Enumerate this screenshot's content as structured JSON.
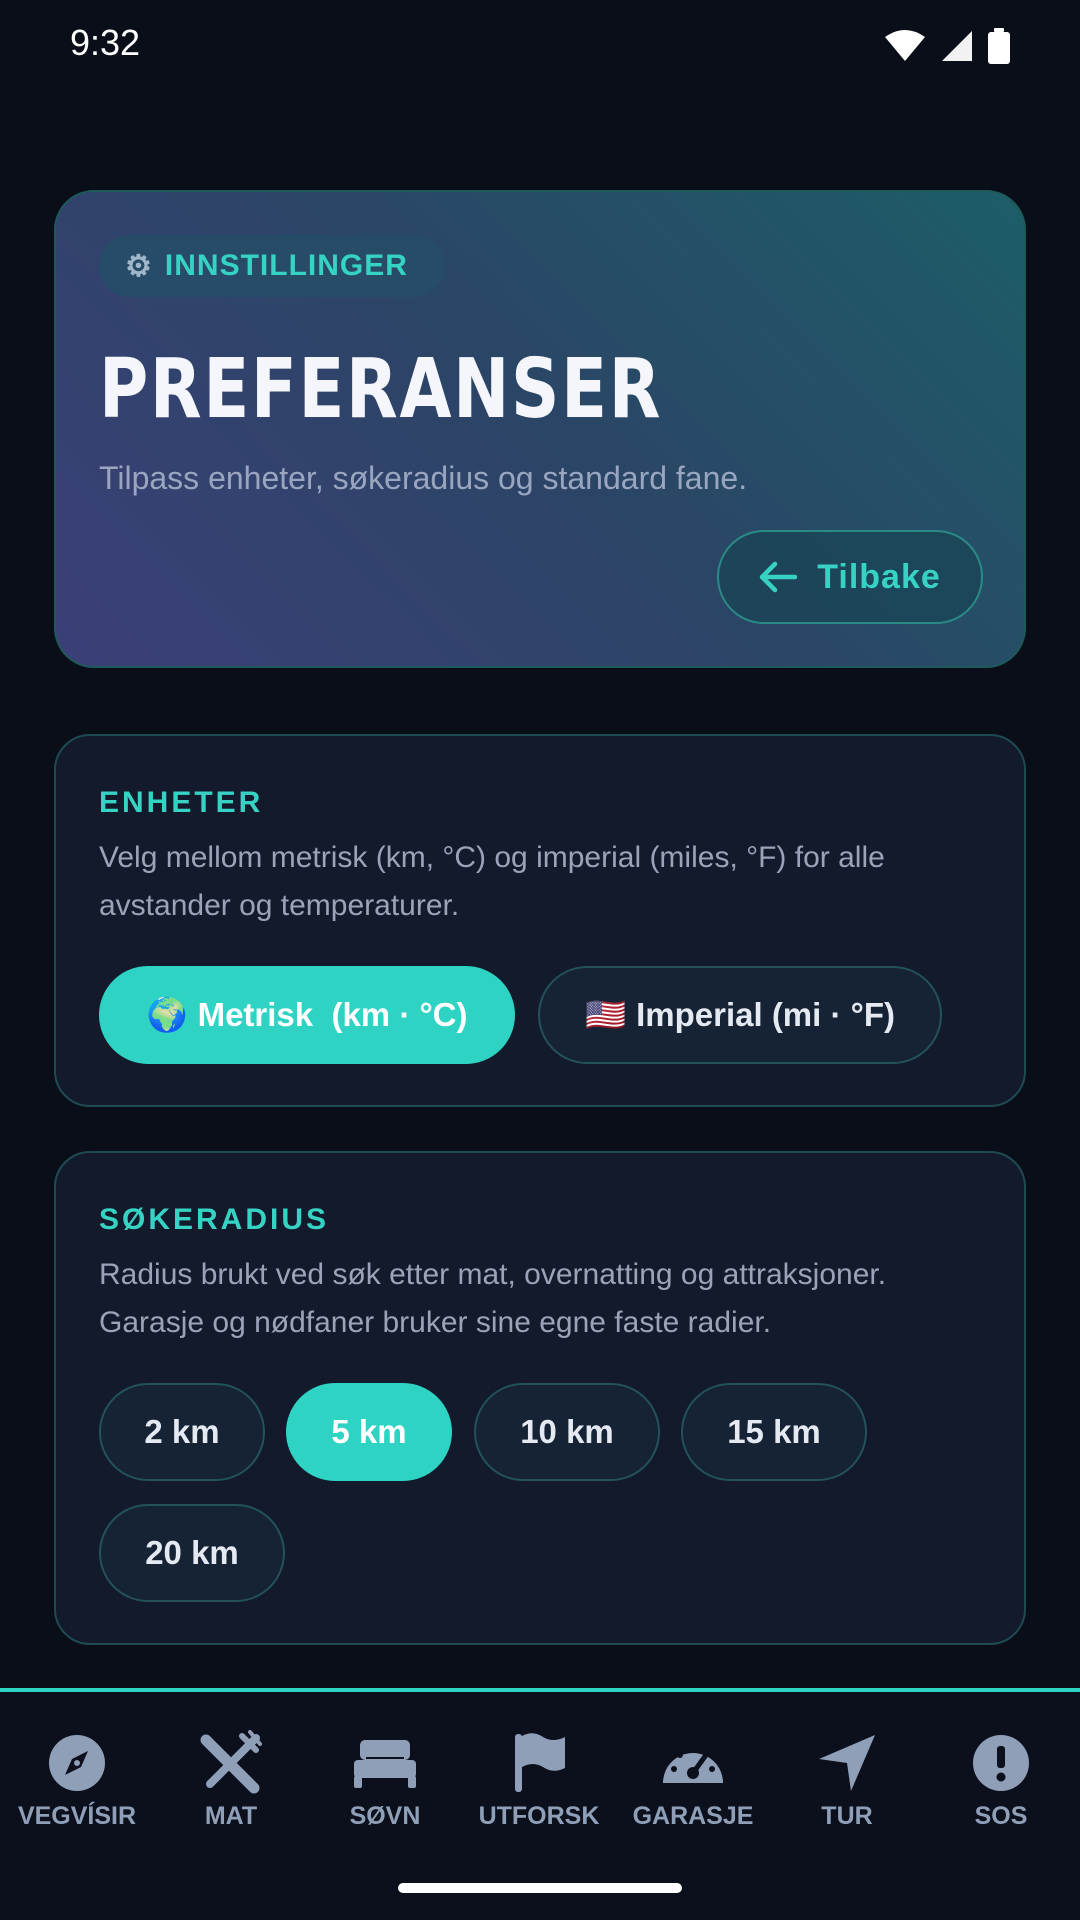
{
  "status_bar": {
    "time": "9:32"
  },
  "header": {
    "tag": "INNSTILLINGER",
    "title": "PREFERANSER",
    "subtitle": "Tilpass enheter, søkeradius og standard fane.",
    "back_label": "Tilbake"
  },
  "units": {
    "label": "ENHETER",
    "description": "Velg mellom metrisk (km, °C) og imperial (miles, °F) for alle avstander og temperaturer.",
    "options": [
      {
        "flag": "🌍",
        "label": "Metrisk  (km · °C)",
        "selected": true
      },
      {
        "flag": "🇺🇸",
        "label": "Imperial (mi · °F)",
        "selected": false
      }
    ]
  },
  "radius": {
    "label": "SØKERADIUS",
    "description": "Radius brukt ved søk etter mat, overnatting og attraksjoner. Garasje og nødfaner bruker sine egne faste radier.",
    "options": [
      "2 km",
      "5 km",
      "10 km",
      "15 km",
      "20 km"
    ],
    "selected": "5 km"
  },
  "nav": [
    {
      "label": "VEGVÍSIR",
      "icon": "compass-icon"
    },
    {
      "label": "MAT",
      "icon": "utensils-icon"
    },
    {
      "label": "SØVN",
      "icon": "bed-icon"
    },
    {
      "label": "UTFORSK",
      "icon": "flag-icon"
    },
    {
      "label": "GARASJE",
      "icon": "speedometer-icon"
    },
    {
      "label": "TUR",
      "icon": "navigation-arrow-icon"
    },
    {
      "label": "SOS",
      "icon": "alert-icon"
    }
  ],
  "colors": {
    "accent": "#2fd3c4",
    "background": "#0a0e18",
    "card": "#131a2b",
    "nav_icon": "#8f9fb8"
  }
}
